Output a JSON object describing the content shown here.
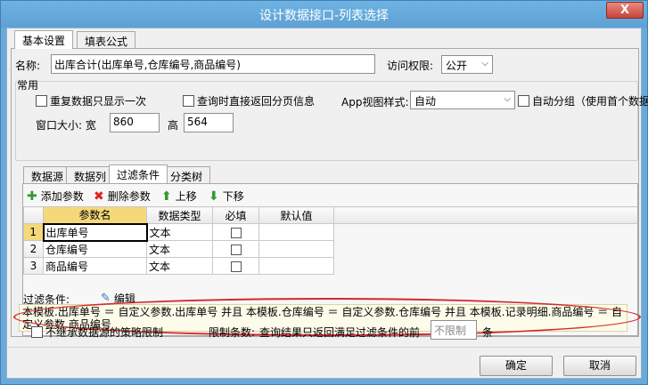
{
  "window": {
    "title": "设计数据接口-列表选择",
    "close_label": "X"
  },
  "tabs": [
    {
      "label": "基本设置"
    },
    {
      "label": "填表公式"
    }
  ],
  "name": {
    "label": "名称:",
    "value": "出库合计(出库单号,仓库编号,商品编号)"
  },
  "access": {
    "label": "访问权限:",
    "value": "公开"
  },
  "common": {
    "title": "常用",
    "dedupe_label": "重复数据只显示一次",
    "paged_label": "查询时直接返回分页信息",
    "app_view_label": "App视图样式:",
    "app_view_value": "自动",
    "auto_group_label": "自动分组（使用首个数据",
    "window_size_label": "窗口大小: 宽",
    "width_value": "860",
    "height_label": "高",
    "height_value": "564"
  },
  "sub_tabs": [
    {
      "label": "数据源"
    },
    {
      "label": "数据列"
    },
    {
      "label": "过滤条件"
    },
    {
      "label": "分类树"
    }
  ],
  "toolbar": {
    "add": "添加参数",
    "delete": "删除参数",
    "up": "上移",
    "down": "下移"
  },
  "params_table": {
    "headers": [
      "参数名",
      "数据类型",
      "必填",
      "默认值"
    ],
    "rows": [
      {
        "num": "1",
        "name": "出库单号",
        "type": "文本"
      },
      {
        "num": "2",
        "name": "仓库编号",
        "type": "文本"
      },
      {
        "num": "3",
        "name": "商品编号",
        "type": "文本"
      }
    ]
  },
  "filter": {
    "label": "过滤条件:",
    "edit_label": "编辑",
    "text": "本模板.出库单号 ＝ 自定义参数.出库单号 并且 本模板.仓库编号 ＝ 自定义参数.仓库编号 并且 本模板.记录明细.商品编号 ＝ 自定义参数.商品编号"
  },
  "bottom": {
    "no_inherit_label": "不继承数据源的策略限制",
    "limit_label": "限制条数:",
    "limit_desc": "查询结果只返回满足过滤条件的前",
    "limit_value": "不限制",
    "limit_suffix": "条"
  },
  "buttons": {
    "ok": "确定",
    "cancel": "取消"
  },
  "colors": {
    "titlebar": "#5da1d4",
    "highlight": "#f5d87a",
    "ellipse": "#d42a2a"
  }
}
